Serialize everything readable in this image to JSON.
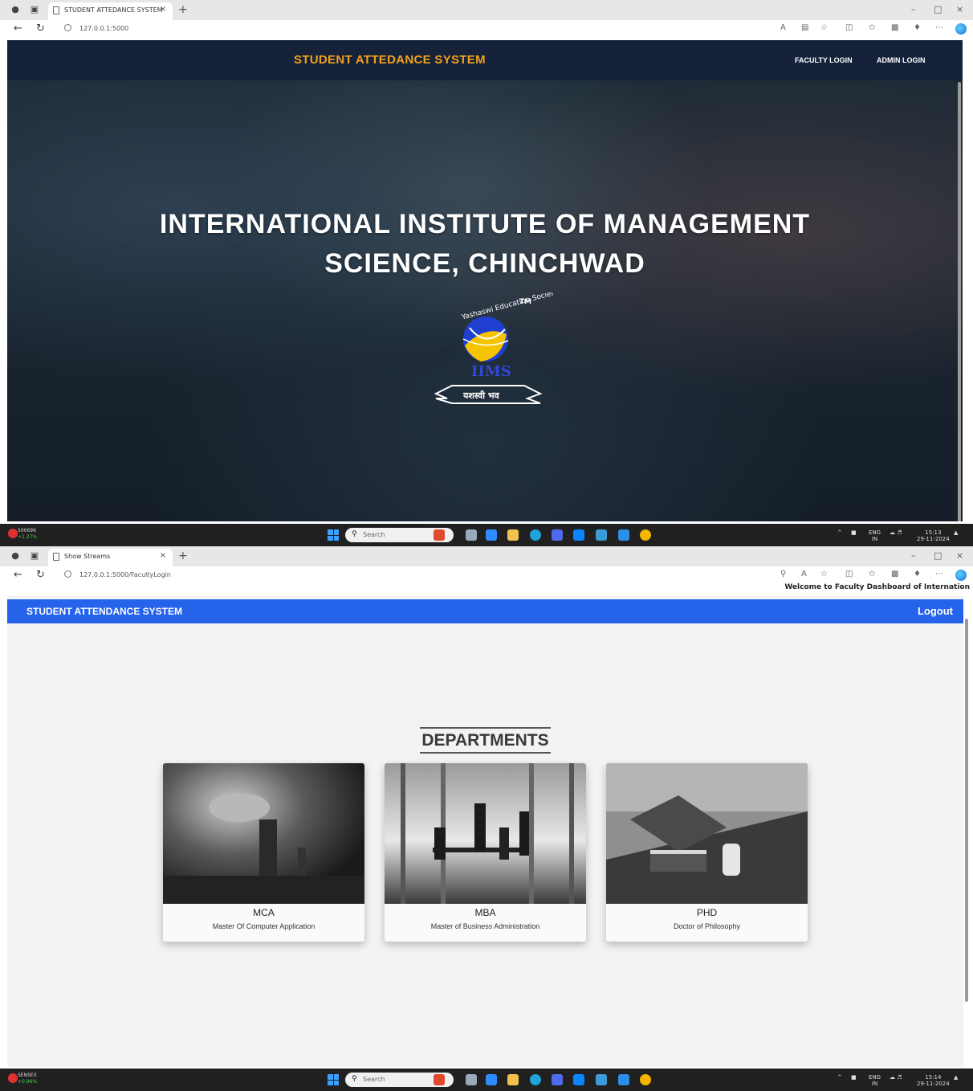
{
  "screen1": {
    "tab_title": "STUDENT ATTEDANCE SYSTEM",
    "url": "127.0.0.1:5000",
    "navbar": {
      "brand": "STUDENT ATTEDANCE SYSTEM",
      "faculty_login": "FACULTY LOGIN",
      "admin_login": "ADMIN LOGIN"
    },
    "hero": {
      "line1": "INTERNATIONAL INSTITUTE OF MANAGEMENT",
      "line2": "SCIENCE, CHINCHWAD"
    },
    "logo": {
      "arc_text": "Yashaswi Education Society",
      "tm": "TM",
      "initials": "IIMS",
      "motto": "यशस्वी भव"
    },
    "taskbar": {
      "ticker": "500696",
      "change": "+1.27%",
      "search": "Search",
      "lang": "ENG",
      "region": "IN",
      "time": "15:13",
      "date": "29-11-2024"
    }
  },
  "screen2": {
    "tab_title": "Show Streams",
    "url": "127.0.0.1:5000/FacultyLogin",
    "marquee": "Welcome to Faculty Dashboard of Internation",
    "navbar": {
      "brand": "STUDENT ATTENDANCE SYSTEM",
      "logout": "Logout"
    },
    "section_title": "DEPARTMENTS",
    "departments": [
      {
        "code": "MCA",
        "name": "Master Of Computer Application"
      },
      {
        "code": "MBA",
        "name": "Master of Business Administration"
      },
      {
        "code": "PHD",
        "name": "Doctor of Philosophy"
      }
    ],
    "taskbar": {
      "ticker": "SENSEX",
      "change": "+0.96%",
      "search": "Search",
      "lang": "ENG",
      "region": "IN",
      "time": "15:14",
      "date": "29-11-2024"
    }
  },
  "colors": {
    "screen1_nav": "#15223a",
    "screen1_brand": "#f3a21b",
    "screen2_nav": "#2563eb",
    "taskbar": "#202020"
  }
}
